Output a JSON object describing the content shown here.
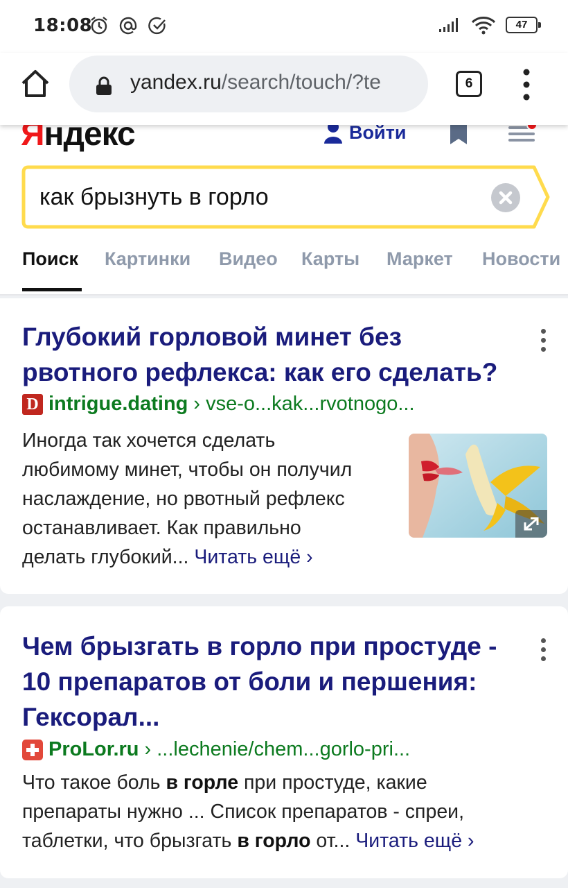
{
  "status_bar": {
    "time": "18:08",
    "battery": "47",
    "icons": [
      "alarm-icon",
      "at-icon",
      "check-circle-icon",
      "signal-icon",
      "wifi-icon",
      "battery-icon"
    ]
  },
  "browser": {
    "url_domain": "yandex.ru",
    "url_path": "/search/touch/?te",
    "tab_count": "6"
  },
  "header": {
    "logo_first": "Я",
    "logo_rest": "ндекс",
    "login_label": "Войти"
  },
  "search": {
    "query": "как брызнуть в горло"
  },
  "nav_tabs": [
    {
      "label": "Поиск",
      "active": true
    },
    {
      "label": "Картинки",
      "active": false
    },
    {
      "label": "Видео",
      "active": false
    },
    {
      "label": "Карты",
      "active": false
    },
    {
      "label": "Маркет",
      "active": false
    },
    {
      "label": "Новости",
      "active": false
    }
  ],
  "results": [
    {
      "title_line1": "Глубокий горловой минет без",
      "title_line2": "рвотного рефлекса: как его сделать?",
      "domain": "intrigue.dating",
      "path": "› vse-o...kak...rvotnogo...",
      "snippet_lines": [
        "Иногда так хочется сделать",
        "любимому минет, чтобы он получил",
        "наслаждение, но рвотный рефлекс",
        "останавливает. Как правильно",
        "делать глубокий..."
      ],
      "read_more": "Читать ещё ›"
    },
    {
      "title_line1": "Чем брызгать в горло при простуде -",
      "title_line2": "10 препаратов от боли и першения:",
      "title_line3": "Гексорал...",
      "domain": "ProLor.ru",
      "path": "› ...lechenie/chem...gorlo-pri...",
      "snippet_l1_a": "Что такое боль ",
      "snippet_l1_b": "в горле",
      "snippet_l1_c": " при простуде, какие",
      "snippet_l2": "препараты нужно ... Список препаратов - спреи,",
      "snippet_l3_a": "таблетки, что брызгать ",
      "snippet_l3_b": "в горло",
      "snippet_l3_c": " от...",
      "read_more": "Читать ещё ›"
    }
  ],
  "colors": {
    "link": "#1a1c7c",
    "domain_green": "#0c7a1f",
    "search_border": "#ffdb4d",
    "logo_red": "#f0181a"
  }
}
